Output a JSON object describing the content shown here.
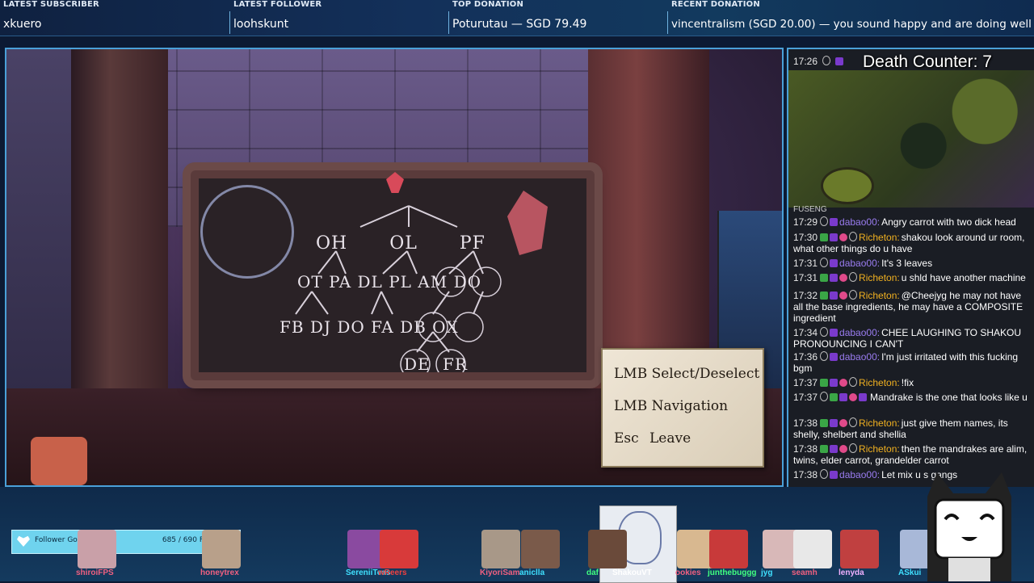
{
  "ticker": {
    "latest_subscriber_label": "LATEST SUBSCRIBER",
    "latest_subscriber": "xkuero",
    "latest_follower_label": "LATEST FOLLOWER",
    "latest_follower": "loohskunt",
    "top_donation_label": "TOP DONATION",
    "top_donation": "Poturutau — SGD 79.49",
    "recent_donation_label": "RECENT DONATION",
    "recent_donation": "vincentralism (SGD 20.00) — you sound happy and are doing well!"
  },
  "game": {
    "board": {
      "row1": "OH OL PF",
      "row2": "OT PA DL PL AM DO",
      "row3": "FB DJ DO FA DB OX",
      "row4": "DE FR"
    },
    "controls": {
      "select": "LMB Select/Deselect",
      "navigation": "LMB Navigation",
      "leave_key": "Esc",
      "leave": "Leave"
    }
  },
  "webcam": {
    "death_counter": "Death Counter: 7",
    "top_time": "17:26"
  },
  "chat": {
    "partial": "FUSENG",
    "messages": [
      {
        "time": "17:29",
        "user": "dabao00:",
        "color": "a",
        "badges": [
          "user",
          "mod"
        ],
        "text": "Angry carrot with two dick head"
      },
      {
        "time": "17:30",
        "user": "Richeton:",
        "color": "b",
        "badges": [
          "sub",
          "mod",
          "heart",
          "user"
        ],
        "text": "shakou look around ur room, what other things do u have"
      },
      {
        "time": "17:31",
        "user": "dabao00:",
        "color": "a",
        "badges": [
          "user",
          "mod"
        ],
        "text": "It's 3 leaves"
      },
      {
        "time": "17:31",
        "user": "Richeton:",
        "color": "b",
        "badges": [
          "sub",
          "mod",
          "heart",
          "user"
        ],
        "text": "u shld have another machine"
      },
      {
        "time": "17:32",
        "user": "Richeton:",
        "color": "b",
        "badges": [
          "sub",
          "mod",
          "heart",
          "user"
        ],
        "text": "@Cheejyg he may not have all the base ingredients, he may have a COMPOSITE ingredient"
      },
      {
        "time": "17:34",
        "user": "dabao00:",
        "color": "a",
        "badges": [
          "user",
          "mod"
        ],
        "text": "CHEE LAUGHING TO SHAKOU PRONOUNCING I CAN'T"
      },
      {
        "time": "17:36",
        "user": "dabao00:",
        "color": "a",
        "badges": [
          "user",
          "mod"
        ],
        "text": "I'm just irritated with this fucking bgm"
      },
      {
        "time": "17:37",
        "user": "Richeton:",
        "color": "b",
        "badges": [
          "sub",
          "mod",
          "heart",
          "user"
        ],
        "text": "!fix"
      },
      {
        "time": "17:37",
        "user": "",
        "color": "a",
        "badges": [
          "user",
          "sub",
          "mod",
          "heart",
          "mod"
        ],
        "text": "Mandrake is the one that looks like u"
      },
      {
        "time": "17:38",
        "user": "Richeton:",
        "color": "b",
        "badges": [
          "sub",
          "mod",
          "heart",
          "user"
        ],
        "text": "just give them names, its shelly, shelbert and shellia"
      },
      {
        "time": "17:38",
        "user": "Richeton:",
        "color": "b",
        "badges": [
          "sub",
          "mod",
          "heart",
          "user"
        ],
        "text": "then the mandrakes are alim, twins, elder carrot, grandelder carrot"
      },
      {
        "time": "17:38",
        "user": "dabao00:",
        "color": "a",
        "badges": [
          "user",
          "mod"
        ],
        "text": "Let mix u s gangs"
      }
    ]
  },
  "bottom": {
    "goal_label": "Follower Goal",
    "goal_count": "685 / 690 Followers",
    "goal_progress": 0.993,
    "viewers": [
      {
        "name": "shiroiFPS",
        "color": "#f06080"
      },
      {
        "name": "honeytrex",
        "color": "#f06080"
      },
      {
        "name": "SereniiTeas",
        "color": "#40e0ff"
      },
      {
        "name": "wReers",
        "color": "#f04040"
      },
      {
        "name": "KiyoriSam",
        "color": "#f06080"
      },
      {
        "name": "aniclla",
        "color": "#40e0ff"
      },
      {
        "name": "daf",
        "color": "#40ff80"
      },
      {
        "name": "ShakouVT",
        "color": "#ffffff"
      },
      {
        "name": "ookies",
        "color": "#f06080"
      },
      {
        "name": "junthebuggg",
        "color": "#40ff80"
      },
      {
        "name": "jyg",
        "color": "#40e0ff"
      },
      {
        "name": "seamh",
        "color": "#f06080"
      },
      {
        "name": "lenyda",
        "color": "#f0b0ff"
      },
      {
        "name": "ASkui",
        "color": "#40e0ff"
      }
    ]
  }
}
